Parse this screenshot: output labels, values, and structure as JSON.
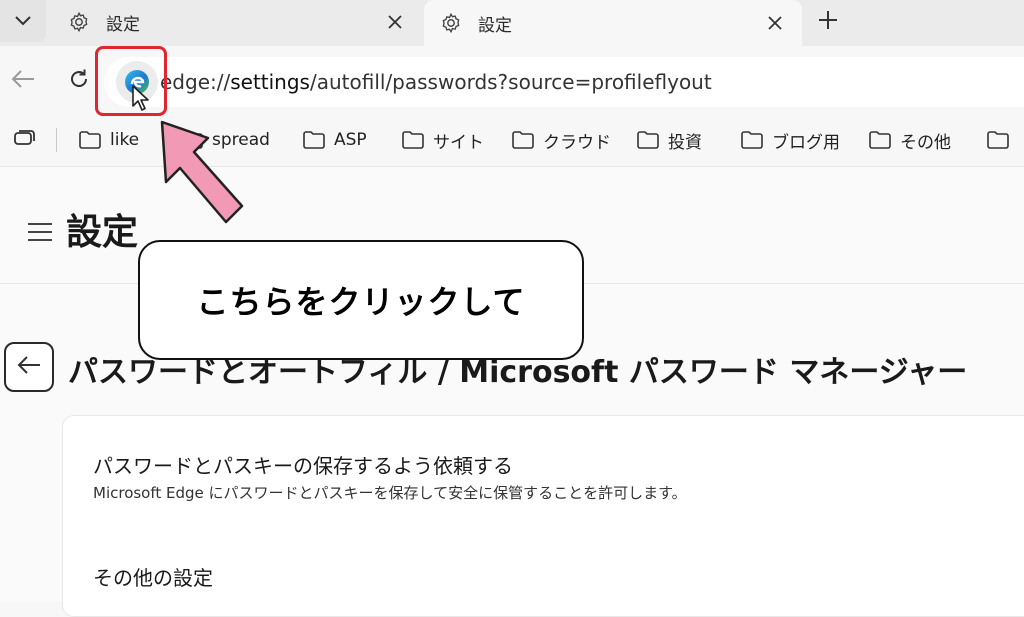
{
  "tabs": [
    {
      "title": "設定",
      "state": "inactive"
    },
    {
      "title": "設定",
      "state": "active"
    }
  ],
  "icons": {
    "tab_menu": "chevron-down-icon",
    "tab_icon": "gear-icon",
    "tab_close": "close-icon",
    "new_tab": "plus-icon",
    "back": "arrow-left-icon",
    "reload": "refresh-icon",
    "site": "edge-logo-icon",
    "collections": "collections-icon",
    "folder": "folder-icon",
    "menu": "hamburger-icon",
    "cursor": "mouse-pointer-icon"
  },
  "address": {
    "prefix": "edge://",
    "host": "settings",
    "path": "/autofill/passwords?source=profileflyout"
  },
  "favorites": [
    "like",
    "spread",
    "ASP",
    "サイト",
    "クラウド",
    "投資",
    "ブログ用",
    "その他",
    ""
  ],
  "settings": {
    "title": "設定",
    "page_heading": "パスワードとオートフィル / Microsoft パスワード マネージャー",
    "card": {
      "setting_title": "パスワードとパスキーの保存するよう依頼する",
      "setting_desc": "Microsoft Edge にパスワードとパスキーを保存して安全に保管することを許可します。",
      "other_title": "その他の設定"
    }
  },
  "annotation": {
    "callout_text": "こちらをクリックして",
    "highlight_color": "#e0262e",
    "arrow_color": "#f29ab5"
  }
}
